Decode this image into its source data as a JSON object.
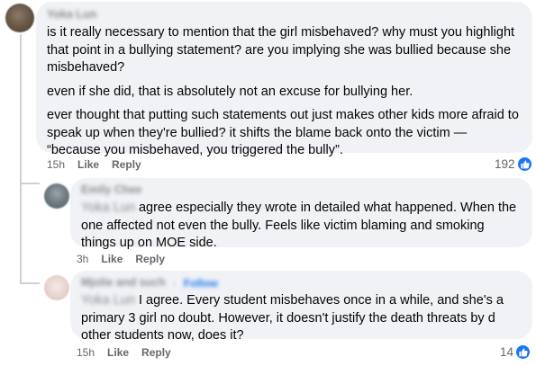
{
  "main_comment": {
    "author": "Yoka Lun",
    "paragraphs": [
      "is it really necessary to mention that the girl misbehaved? why must you highlight that point in a bullying statement? are you implying she was bullied because she misbehaved?",
      "even if she did, that is absolutely not an excuse for bullying her.",
      "ever thought that putting such statements out just makes other kids more afraid to speak up when they're bullied? it shifts the blame back onto the victim — “because you misbehaved, you triggered the bully”."
    ],
    "time": "15h",
    "like_label": "Like",
    "reply_label": "Reply",
    "reaction_count": "192",
    "reaction_icon": "like-icon",
    "accent": "#1877f2"
  },
  "replies": [
    {
      "author": "Emily Chee",
      "mention": "Yoka Lun",
      "text": "agree especially they wrote in detailed what happened. When the one affected not even the bully. Feels like victim blaming and smoking things up on MOE side.",
      "time": "3h",
      "like_label": "Like",
      "reply_label": "Reply"
    },
    {
      "author": "Mjolie and such",
      "follow_label": "Follow",
      "mention": "Yoka Lun",
      "text": "I agree. Every student misbehaves once in a while, and she's a primary 3 girl no doubt. However, it doesn't justify the death threats by d other students now, does it?",
      "time": "15h",
      "like_label": "Like",
      "reply_label": "Reply",
      "reaction_count": "14",
      "reaction_icon": "like-icon"
    }
  ]
}
